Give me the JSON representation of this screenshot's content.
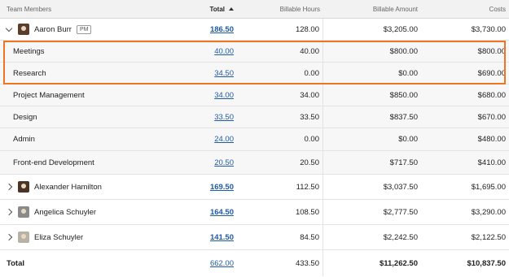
{
  "header": {
    "team_members": "Team Members",
    "total": "Total",
    "billable_hours": "Billable Hours",
    "billable_amount": "Billable Amount",
    "costs": "Costs"
  },
  "rows": [
    {
      "name": "Aaron Burr",
      "badge": "PM",
      "total": "186.50",
      "hours": "128.00",
      "amount": "$3,205.00",
      "costs": "$3,730.00"
    },
    {
      "name": "Meetings",
      "total": "40.00",
      "hours": "40.00",
      "amount": "$800.00",
      "costs": "$800.00"
    },
    {
      "name": "Research",
      "total": "34.50",
      "hours": "0.00",
      "amount": "$0.00",
      "costs": "$690.00"
    },
    {
      "name": "Project Management",
      "total": "34.00",
      "hours": "34.00",
      "amount": "$850.00",
      "costs": "$680.00"
    },
    {
      "name": "Design",
      "total": "33.50",
      "hours": "33.50",
      "amount": "$837.50",
      "costs": "$670.00"
    },
    {
      "name": "Admin",
      "total": "24.00",
      "hours": "0.00",
      "amount": "$0.00",
      "costs": "$480.00"
    },
    {
      "name": "Front-end Development",
      "total": "20.50",
      "hours": "20.50",
      "amount": "$717.50",
      "costs": "$410.00"
    },
    {
      "name": "Alexander Hamilton",
      "total": "169.50",
      "hours": "112.50",
      "amount": "$3,037.50",
      "costs": "$1,695.00"
    },
    {
      "name": "Angelica Schuyler",
      "total": "164.50",
      "hours": "108.50",
      "amount": "$2,777.50",
      "costs": "$3,290.00"
    },
    {
      "name": "Eliza Schuyler",
      "total": "141.50",
      "hours": "84.50",
      "amount": "$2,242.50",
      "costs": "$2,122.50"
    }
  ],
  "footer": {
    "label": "Total",
    "total": "662.00",
    "hours": "433.50",
    "amount": "$11,262.50",
    "costs": "$10,837.50"
  },
  "colors": {
    "highlight": "#ee7622",
    "link": "#1f5aa6"
  }
}
